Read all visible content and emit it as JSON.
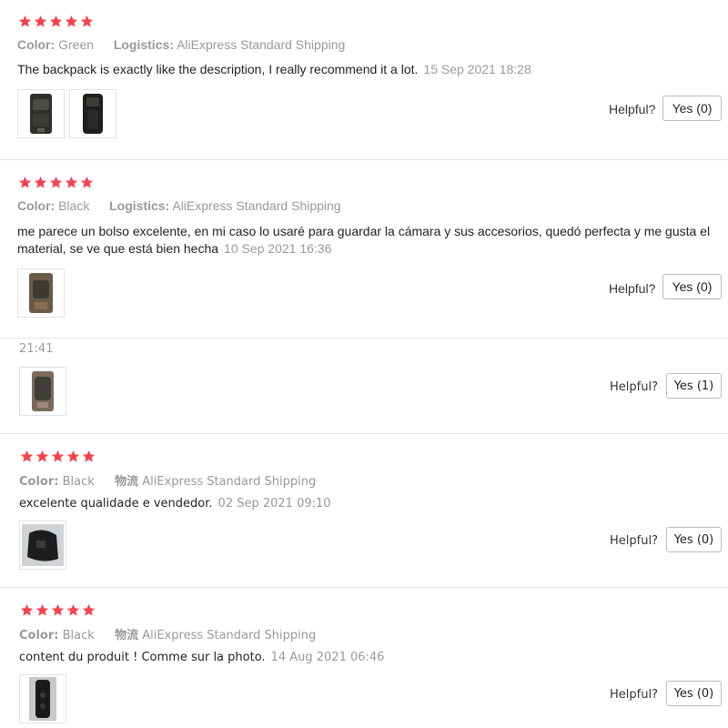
{
  "reviews": [
    {
      "rating": 5,
      "color_label": "Color:",
      "color_value": "Green",
      "logistics_label": "Logistics:",
      "logistics_value": "AliExpress Standard Shipping",
      "text": "The backpack is exactly like the description, I really recommend it a lot.",
      "date": "15 Sep 2021 18:28",
      "helpful_label": "Helpful?",
      "yes_label": "Yes (0)"
    },
    {
      "rating": 5,
      "color_label": "Color:",
      "color_value": "Black",
      "logistics_label": "Logistics:",
      "logistics_value": "AliExpress Standard Shipping",
      "text": "me parece un bolso excelente, en mi caso lo usaré para guardar la cámara y sus accesorios, quedó perfecta y me gusta el material, se ve que está bien hecha",
      "date": "10 Sep 2021 16:36",
      "helpful_label": "Helpful?",
      "yes_label": "Yes (0)"
    },
    {
      "date": "21:41",
      "helpful_label": "Helpful?",
      "yes_label": "Yes (1)"
    },
    {
      "rating": 5,
      "color_label": "Color:",
      "color_value": "Black",
      "logistics_label": "物流",
      "logistics_value": "AliExpress Standard Shipping",
      "text": "excelente qualidade e vendedor.",
      "date": "02 Sep 2021 09:10",
      "helpful_label": "Helpful?",
      "yes_label": "Yes (0)"
    },
    {
      "rating": 5,
      "color_label": "Color:",
      "color_value": "Black",
      "logistics_label": "物流",
      "logistics_value": "AliExpress Standard Shipping",
      "text": "content du produit ! Comme sur la photo.",
      "date": "14 Aug 2021 06:46",
      "helpful_label": "Helpful?",
      "yes_label": "Yes (0)"
    }
  ],
  "colors": {
    "star": "#f5424f",
    "meta": "#999999",
    "divider": "#e6e6e6"
  },
  "icons": {
    "star": "star-icon",
    "photo": "review-photo"
  }
}
